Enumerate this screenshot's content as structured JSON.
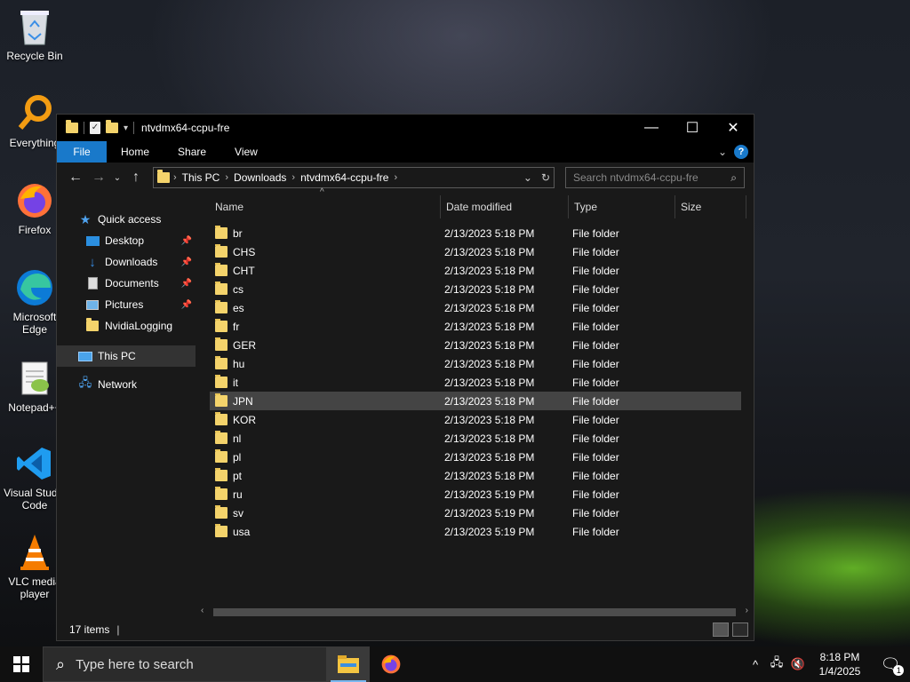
{
  "desktop": {
    "icons": [
      {
        "label": "Recycle Bin",
        "icon": "recycle-bin-icon"
      },
      {
        "label": "Everything",
        "icon": "everything-search-icon"
      },
      {
        "label": "Firefox",
        "icon": "firefox-icon"
      },
      {
        "label": "Microsoft Edge",
        "icon": "edge-icon"
      },
      {
        "label": "Notepad++",
        "icon": "notepadpp-icon"
      },
      {
        "label": "Visual Studio Code",
        "icon": "vscode-icon"
      },
      {
        "label": "VLC media player",
        "icon": "vlc-icon"
      }
    ]
  },
  "window": {
    "title": "ntvdmx64-ccpu-fre",
    "controls": {
      "minimize": "—",
      "maximize": "☐",
      "close": "✕"
    },
    "ribbon_tabs": [
      "File",
      "Home",
      "Share",
      "View"
    ],
    "breadcrumb": [
      "This PC",
      "Downloads",
      "ntvdmx64-ccpu-fre"
    ],
    "search_placeholder": "Search ntvdmx64-ccpu-fre",
    "sidebar": [
      {
        "label": "Quick access",
        "icon": "star-icon",
        "pinned": false
      },
      {
        "label": "Desktop",
        "icon": "desktop-folder-icon",
        "pinned": true
      },
      {
        "label": "Downloads",
        "icon": "download-arrow-icon",
        "pinned": true
      },
      {
        "label": "Documents",
        "icon": "document-icon",
        "pinned": true
      },
      {
        "label": "Pictures",
        "icon": "pictures-icon",
        "pinned": true
      },
      {
        "label": "NvidiaLogging",
        "icon": "folder-icon",
        "pinned": false
      },
      {
        "label": "This PC",
        "icon": "computer-icon",
        "pinned": false,
        "selected": true
      },
      {
        "label": "Network",
        "icon": "network-icon",
        "pinned": false
      }
    ],
    "columns": [
      "Name",
      "Date modified",
      "Type",
      "Size"
    ],
    "files": [
      {
        "name": "br",
        "date": "2/13/2023 5:18 PM",
        "type": "File folder"
      },
      {
        "name": "CHS",
        "date": "2/13/2023 5:18 PM",
        "type": "File folder"
      },
      {
        "name": "CHT",
        "date": "2/13/2023 5:18 PM",
        "type": "File folder"
      },
      {
        "name": "cs",
        "date": "2/13/2023 5:18 PM",
        "type": "File folder"
      },
      {
        "name": "es",
        "date": "2/13/2023 5:18 PM",
        "type": "File folder"
      },
      {
        "name": "fr",
        "date": "2/13/2023 5:18 PM",
        "type": "File folder"
      },
      {
        "name": "GER",
        "date": "2/13/2023 5:18 PM",
        "type": "File folder"
      },
      {
        "name": "hu",
        "date": "2/13/2023 5:18 PM",
        "type": "File folder"
      },
      {
        "name": "it",
        "date": "2/13/2023 5:18 PM",
        "type": "File folder"
      },
      {
        "name": "JPN",
        "date": "2/13/2023 5:18 PM",
        "type": "File folder",
        "highlight": true
      },
      {
        "name": "KOR",
        "date": "2/13/2023 5:18 PM",
        "type": "File folder"
      },
      {
        "name": "nl",
        "date": "2/13/2023 5:18 PM",
        "type": "File folder"
      },
      {
        "name": "pl",
        "date": "2/13/2023 5:18 PM",
        "type": "File folder"
      },
      {
        "name": "pt",
        "date": "2/13/2023 5:18 PM",
        "type": "File folder"
      },
      {
        "name": "ru",
        "date": "2/13/2023 5:19 PM",
        "type": "File folder"
      },
      {
        "name": "sv",
        "date": "2/13/2023 5:19 PM",
        "type": "File folder"
      },
      {
        "name": "usa",
        "date": "2/13/2023 5:19 PM",
        "type": "File folder"
      }
    ],
    "status": "17 items"
  },
  "taskbar": {
    "search_placeholder": "Type here to search",
    "apps": [
      {
        "icon": "file-explorer-icon",
        "active": true
      },
      {
        "icon": "firefox-icon",
        "active": false
      }
    ],
    "time": "8:18 PM",
    "date": "1/4/2025",
    "notification_count": "1"
  },
  "colors": {
    "accent": "#1979ca",
    "folder": "#f4d36b",
    "window_bg": "#191919"
  }
}
